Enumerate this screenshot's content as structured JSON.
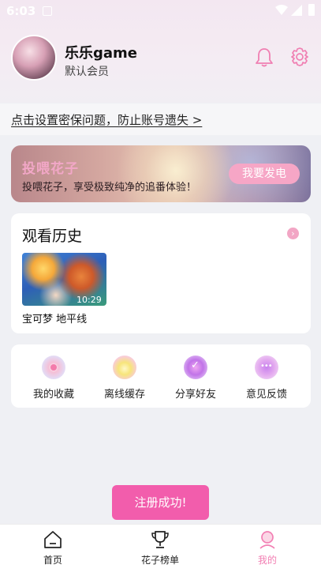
{
  "status_bar": {
    "time": "6:03"
  },
  "profile": {
    "username": "乐乐game",
    "member_level": "默认会员"
  },
  "header_icons": {
    "notification": "bell-icon",
    "settings": "gear-icon"
  },
  "notice": {
    "text": "点击设置密保问题，防止账号遗失 >"
  },
  "banner": {
    "title": "投喂花子",
    "subtitle": "投喂花子，享受极致纯净的追番体验！",
    "button_label": "我要发电"
  },
  "history": {
    "title": "观看历史",
    "items": [
      {
        "title": "宝可梦 地平线",
        "progress_time": "10:29"
      }
    ]
  },
  "features": [
    {
      "label": "我的收藏",
      "icon": "favorite-icon"
    },
    {
      "label": "离线缓存",
      "icon": "offline-cache-icon"
    },
    {
      "label": "分享好友",
      "icon": "share-icon"
    },
    {
      "label": "意见反馈",
      "icon": "feedback-icon"
    }
  ],
  "toast": {
    "text": "注册成功!"
  },
  "bottom_nav": [
    {
      "label": "首页",
      "icon": "home-icon",
      "active": false
    },
    {
      "label": "花子榜单",
      "icon": "trophy-icon",
      "active": false
    },
    {
      "label": "我的",
      "icon": "profile-icon",
      "active": true
    }
  ],
  "colors": {
    "accent_pink": "#f25dac",
    "active_tab": "#f27fb3"
  }
}
